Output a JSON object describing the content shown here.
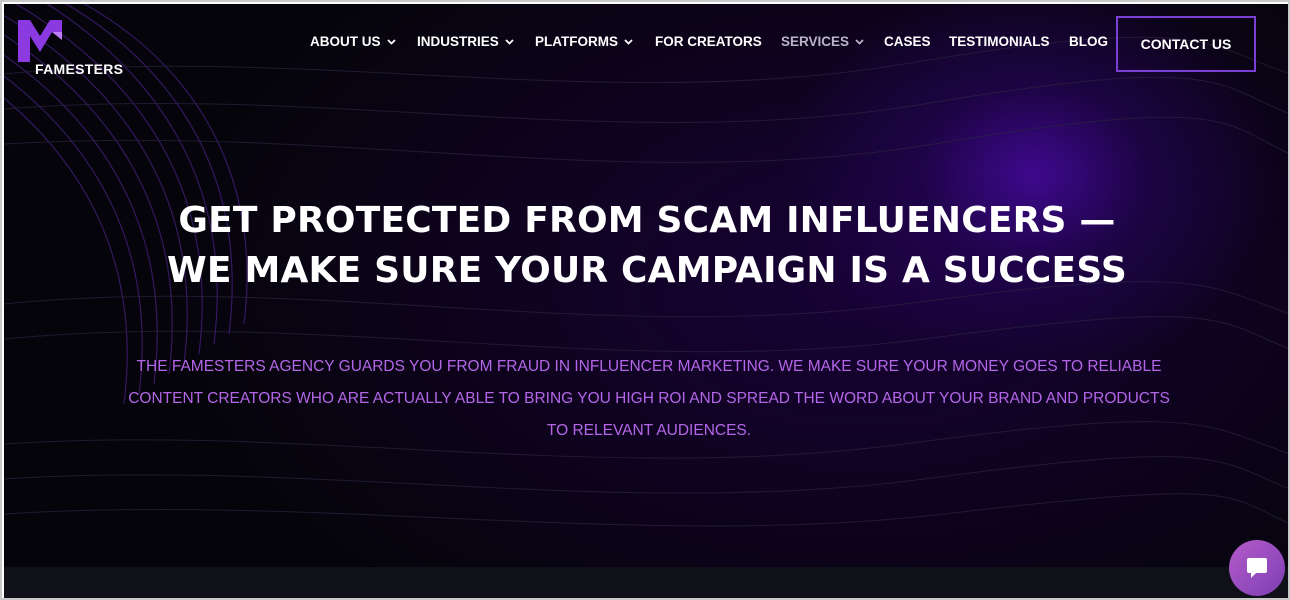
{
  "brand": {
    "name": "FAMESTERS",
    "accent": "#7a3fd4",
    "subtext_color": "#b466e8"
  },
  "nav": {
    "items": [
      {
        "label": "ABOUT US",
        "dropdown": true
      },
      {
        "label": "INDUSTRIES",
        "dropdown": true
      },
      {
        "label": "PLATFORMS",
        "dropdown": true
      },
      {
        "label": "FOR CREATORS",
        "dropdown": false
      },
      {
        "label": "SERVICES",
        "dropdown": true,
        "active": true
      },
      {
        "label": "CASES",
        "dropdown": false
      },
      {
        "label": "TESTIMONIALS",
        "dropdown": false
      },
      {
        "label": "BLOG",
        "dropdown": false
      }
    ],
    "contact_label": "CONTACT US"
  },
  "hero": {
    "headline_line1": "GET PROTECTED FROM SCAM INFLUENCERS —",
    "headline_line2": "WE MAKE SURE YOUR CAMPAIGN IS A SUCCESS",
    "sub_line1": "THE FAMESTERS AGENCY GUARDS YOU FROM FRAUD IN INFLUENCER MARKETING. WE MAKE SURE YOUR MONEY GOES TO RELIABLE",
    "sub_line2": "CONTENT CREATORS WHO ARE ACTUALLY ABLE TO BRING YOU HIGH ROI AND SPREAD THE WORD ABOUT YOUR BRAND AND PRODUCTS",
    "sub_line3": "TO RELEVANT AUDIENCES."
  },
  "icons": {
    "chevron": "chevron-down-icon",
    "chat": "chat-bubble-icon",
    "logo": "famesters-logo-mark"
  }
}
